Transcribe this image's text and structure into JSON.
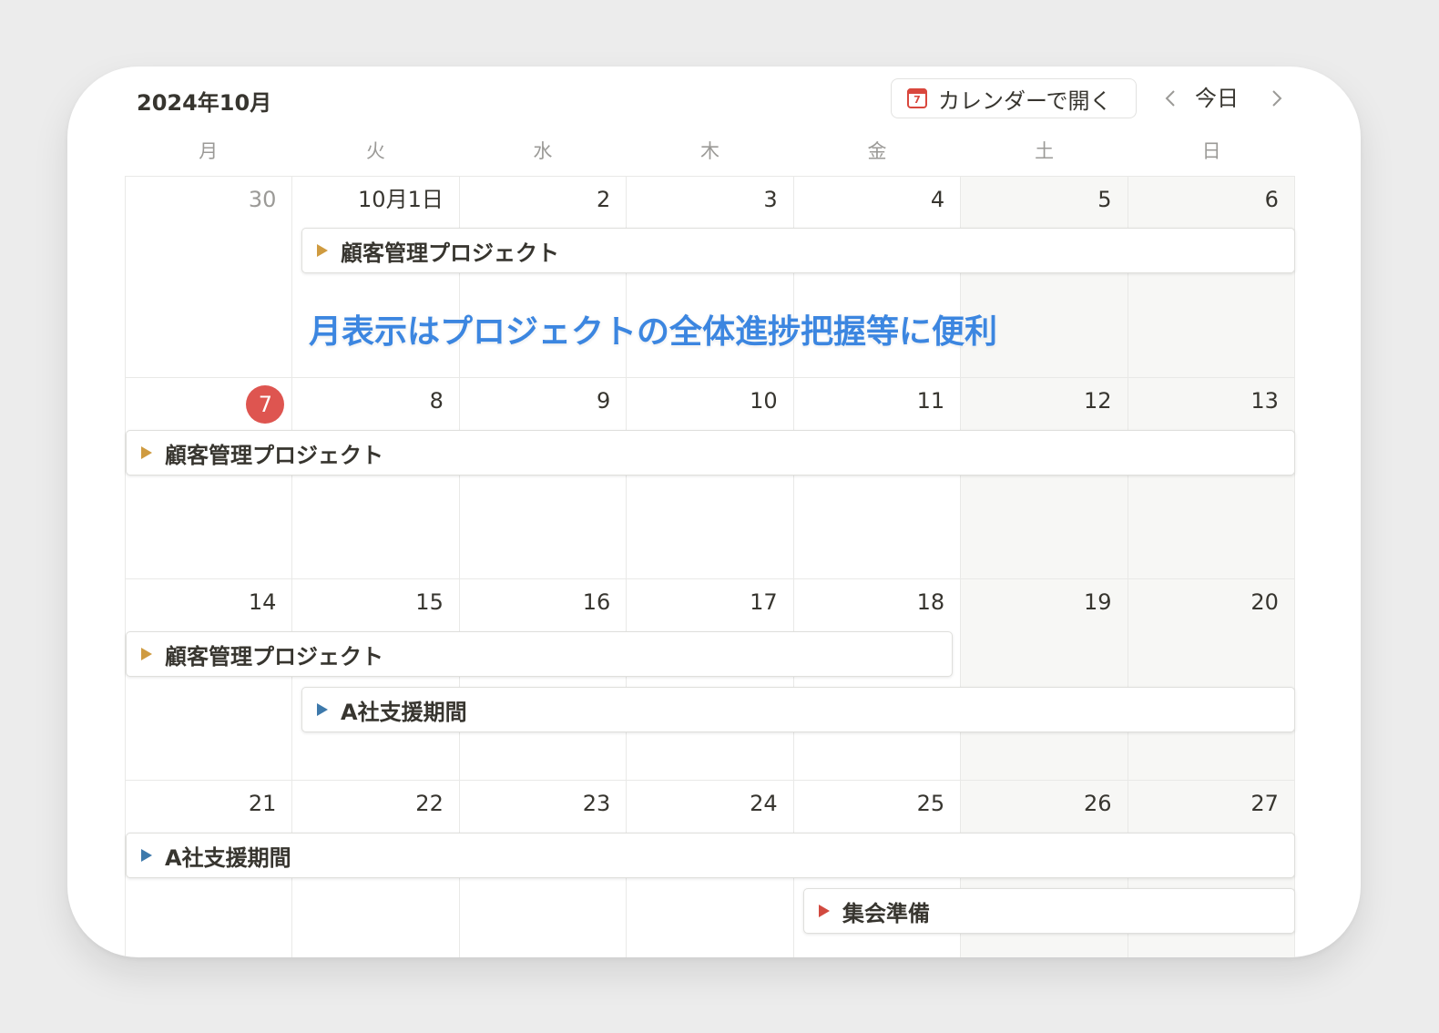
{
  "header": {
    "month_title": "2024年10月",
    "open_calendar_label": "カレンダーで開く",
    "open_calendar_icon_text": "7",
    "today_label": "今日"
  },
  "weekdays": [
    "月",
    "火",
    "水",
    "木",
    "金",
    "土",
    "日"
  ],
  "weeks": [
    {
      "days": [
        "30",
        "10月1日",
        "2",
        "3",
        "4",
        "5",
        "6"
      ]
    },
    {
      "days": [
        "7",
        "8",
        "9",
        "10",
        "11",
        "12",
        "13"
      ]
    },
    {
      "days": [
        "14",
        "15",
        "16",
        "17",
        "18",
        "19",
        "20"
      ]
    },
    {
      "days": [
        "21",
        "22",
        "23",
        "24",
        "25",
        "26",
        "27"
      ]
    }
  ],
  "events": {
    "e1": "顧客管理プロジェクト",
    "e2": "顧客管理プロジェクト",
    "e3": "顧客管理プロジェクト",
    "e4": "A社支援期間",
    "e5": "A社支援期間",
    "e6": "集会準備"
  },
  "annotation": "月表示はプロジェクトの全体進捗把握等に便利",
  "colors": {
    "today_circle": "#de5550",
    "event_project": "#cf9b40",
    "event_support": "#3d79ab",
    "event_meeting": "#d24a40",
    "annotation": "#3c86e0"
  }
}
